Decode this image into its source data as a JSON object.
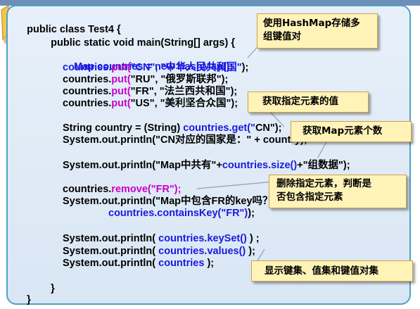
{
  "code": {
    "line1": "public class Test4 {",
    "line2": "public static void main(String[] args) {",
    "line3_a": "Map countries = new HashMap();",
    "line4_a": "countries.",
    "line4_b": "put(",
    "line4_c": "\"CN\", \"中华人民共和国\"",
    "line4_d": ");",
    "line5_a": "countries.",
    "line5_b": "put(",
    "line5_c": "\"RU\", \"俄罗斯联邦\");",
    "line6_a": "countries.",
    "line6_b": "put(",
    "line6_c": "\"FR\", \"法兰西共和国\"",
    "line6_d": ");",
    "line7_a": "countries.",
    "line7_b": "put(",
    "line7_c": "\"US\", \"美利坚合众国\"",
    "line7_d": ");",
    "line8_a": "String country = (String) ",
    "line8_b": "countries.get(\"",
    "line8_c": "CN\");",
    "line9_a": "System.out.println(\"CN对应的国家是：\" + ",
    "line9_b": "country",
    "line9_c": ");",
    "line10_a": "System.out.println(\"Map中共有\"+",
    "line10_b": "countries.size()",
    "line10_c": "+\"组数据\");",
    "line11_a": "countries.",
    "line11_b": "remove(\"FR\");",
    "line12_a": "System.out.println(\"Map中包含FR的",
    "line12_b": "key吗？\" + ",
    "line13_a": "countries.containsKey(\"FR\")",
    "line13_b": ");",
    "line14_a": "System.out.println( ",
    "line14_b": "countries.keySet()",
    "line14_c": " ) ;",
    "line15_a": "System.out.println( ",
    "line15_b": "countries.values()",
    "line15_c": " );",
    "line16_a": "System.out.println( ",
    "line16_b": "countries",
    "line16_c": " );",
    "line17": "}",
    "line18": "}"
  },
  "callouts": {
    "hashmap_line1": "使用HashMap存储多",
    "hashmap_line2": "组键值对",
    "get_value": "获取指定元素的值",
    "size": "获取Map元素个数",
    "remove_line1": "删除指定元素，判断是",
    "remove_line2": "否包含指定元素",
    "views": "显示键集、值集和键值对集"
  },
  "colors": {
    "panel_border": "#4ba3c7",
    "panel_bg": "#e7f0fa",
    "method_blue": "#1a1adf",
    "method_magenta": "#c800c8",
    "callout_bg": "#fff3b8",
    "callout_border": "#c9a24a"
  }
}
